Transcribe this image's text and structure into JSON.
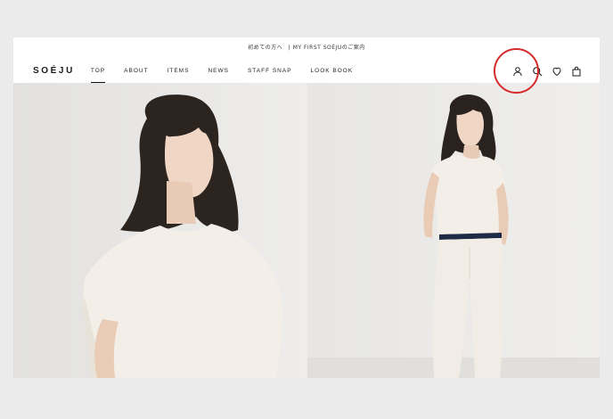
{
  "announcement": "初めての方へ　| MY FIRST SOÉJUのご案内",
  "brand": {
    "logo": "SOÉJU"
  },
  "nav": [
    {
      "label": "TOP",
      "active": true
    },
    {
      "label": "ABOUT",
      "active": false
    },
    {
      "label": "ITEMS",
      "active": false
    },
    {
      "label": "NEWS",
      "active": false
    },
    {
      "label": "STAFF SNAP",
      "active": false
    },
    {
      "label": "LOOK BOOK",
      "active": false
    }
  ],
  "header_icons": [
    "account-icon",
    "search-icon",
    "favorite-heart-icon",
    "shopping-bag-icon"
  ],
  "colors": {
    "annotation": "#d62a2a",
    "text": "#1a1a1a",
    "page_bg": "#ebebeb"
  }
}
